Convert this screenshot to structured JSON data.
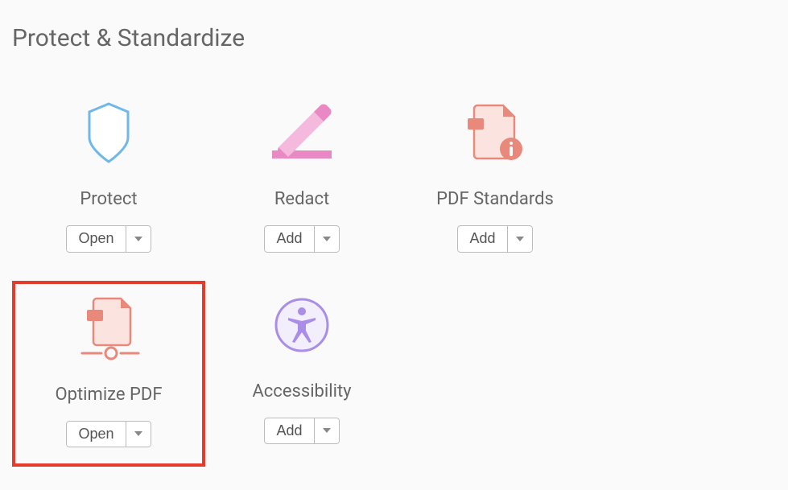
{
  "section": {
    "title": "Protect & Standardize"
  },
  "tools": {
    "protect": {
      "label": "Protect",
      "button": "Open"
    },
    "redact": {
      "label": "Redact",
      "button": "Add"
    },
    "pdf_standards": {
      "label": "PDF Standards",
      "button": "Add"
    },
    "optimize_pdf": {
      "label": "Optimize PDF",
      "button": "Open"
    },
    "accessibility": {
      "label": "Accessibility",
      "button": "Add"
    }
  }
}
